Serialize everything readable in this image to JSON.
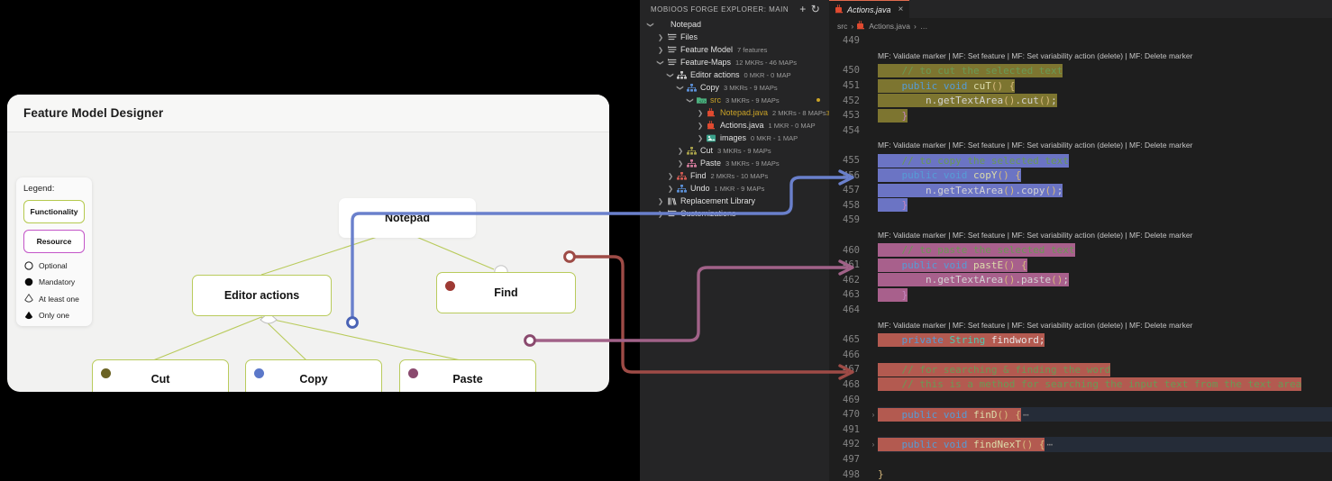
{
  "designer": {
    "title": "Feature Model Designer",
    "legend": {
      "title": "Legend:",
      "chips": [
        {
          "label": "Functionality",
          "color": "#b5c94e"
        },
        {
          "label": "Resource",
          "color": "#c355c8"
        }
      ],
      "symbols": [
        {
          "name": "optional",
          "label": "Optional"
        },
        {
          "name": "mandatory",
          "label": "Mandatory"
        },
        {
          "name": "at-least-one",
          "label": "At least one"
        },
        {
          "name": "only-one",
          "label": "Only one"
        }
      ]
    },
    "nodes": [
      {
        "id": "notepad",
        "label": "Notepad",
        "dot": null
      },
      {
        "id": "editor-actions",
        "label": "Editor actions",
        "dot": null
      },
      {
        "id": "find",
        "label": "Find",
        "dot": "#9e3a34"
      },
      {
        "id": "cut",
        "label": "Cut",
        "dot": "#6b6324"
      },
      {
        "id": "copy",
        "label": "Copy",
        "dot": "#5b78c9"
      },
      {
        "id": "paste",
        "label": "Paste",
        "dot": "#8a4a6e"
      }
    ],
    "trace_colors": {
      "copy": "#6a80cc",
      "find": "#9e4b46",
      "paste": "#a16288"
    }
  },
  "explorer": {
    "header": {
      "title": "MOBIOOS FORGE EXPLORER: MAIN",
      "add_icon": "plus-icon",
      "refresh_icon": "refresh-icon"
    },
    "tree": [
      {
        "indent": 0,
        "tw": "v",
        "icon": "none",
        "label": "Notepad",
        "meta": ""
      },
      {
        "indent": 1,
        "tw": ">",
        "icon": "list",
        "label": "Files",
        "meta": ""
      },
      {
        "indent": 1,
        "tw": ">",
        "icon": "list",
        "label": "Feature Model",
        "meta": "7 features"
      },
      {
        "indent": 1,
        "tw": "v",
        "icon": "list",
        "label": "Feature-Maps",
        "meta": "12 MKRs - 46 MAPs"
      },
      {
        "indent": 2,
        "tw": "v",
        "icon": "hier-grey",
        "label": "Editor actions",
        "meta": "0 MKR - 0 MAP"
      },
      {
        "indent": 3,
        "tw": "v",
        "icon": "hier-blue",
        "label": "Copy",
        "meta": "3 MKRs - 9 MAPs"
      },
      {
        "indent": 4,
        "tw": "v",
        "icon": "folder",
        "label": "src",
        "meta": "3 MKRs - 9 MAPs",
        "label_color": "#c9a227",
        "dotmark": true
      },
      {
        "indent": 5,
        "tw": ">",
        "icon": "java",
        "label": "Notepad.java",
        "meta": "2 MKRs - 8 MAPs",
        "label_color": "#c9a227",
        "badge": "3"
      },
      {
        "indent": 5,
        "tw": ">",
        "icon": "java",
        "label": "Actions.java",
        "meta": "1 MKR - 0 MAP"
      },
      {
        "indent": 5,
        "tw": ">",
        "icon": "images",
        "label": "images",
        "meta": "0 MKR - 1 MAP"
      },
      {
        "indent": 3,
        "tw": ">",
        "icon": "hier-olive",
        "label": "Cut",
        "meta": "3 MKRs - 9 MAPs"
      },
      {
        "indent": 3,
        "tw": ">",
        "icon": "hier-pink",
        "label": "Paste",
        "meta": "3 MKRs - 9 MAPs"
      },
      {
        "indent": 2,
        "tw": ">",
        "icon": "hier-red",
        "label": "Find",
        "meta": "2 MKRs - 10 MAPs"
      },
      {
        "indent": 2,
        "tw": ">",
        "icon": "hier-blue",
        "label": "Undo",
        "meta": "1 MKR - 9 MAPs"
      },
      {
        "indent": 1,
        "tw": ">",
        "icon": "library",
        "label": "Replacement Library",
        "meta": ""
      },
      {
        "indent": 1,
        "tw": ">",
        "icon": "list",
        "label": "Customizations",
        "meta": ""
      }
    ]
  },
  "editor": {
    "tab": {
      "label": "Actions.java",
      "icon": "java-icon",
      "close": "×"
    },
    "breadcrumb": {
      "root": "src",
      "file": "Actions.java",
      "more": "…",
      "sep": "›"
    },
    "marker_text": "MF: Validate marker | MF: Set feature | MF: Set variability action (delete) | MF: Delete marker",
    "lines": [
      {
        "num": "449"
      },
      {
        "marker": true
      },
      {
        "num": "450",
        "hl": "#7d7530",
        "tokens": [
          {
            "t": "    // to cut the selected text",
            "c": "c"
          }
        ]
      },
      {
        "num": "451",
        "hl": "#7d7530",
        "tokens": [
          {
            "t": "    ",
            "c": "n"
          },
          {
            "t": "public",
            "c": "k"
          },
          {
            "t": " ",
            "c": "n"
          },
          {
            "t": "void",
            "c": "k"
          },
          {
            "t": " ",
            "c": "n"
          },
          {
            "t": "cuT",
            "c": "m"
          },
          {
            "t": "()",
            "c": "y"
          },
          {
            "t": " {",
            "c": "y"
          }
        ]
      },
      {
        "num": "452",
        "hl": "#7d7530",
        "tokens": [
          {
            "t": "        n.getTextArea",
            "c": "n"
          },
          {
            "t": "()",
            "c": "y"
          },
          {
            "t": ".cut",
            "c": "n"
          },
          {
            "t": "()",
            "c": "y"
          },
          {
            "t": ";",
            "c": "n"
          }
        ]
      },
      {
        "num": "453",
        "hl": "#7d7530",
        "tokens": [
          {
            "t": "    }",
            "c": "p"
          }
        ]
      },
      {
        "num": "454"
      },
      {
        "marker": true
      },
      {
        "num": "455",
        "hl": "#6b74c4",
        "tokens": [
          {
            "t": "    // to copy the selected text",
            "c": "c"
          }
        ]
      },
      {
        "num": "456",
        "hl": "#6b74c4",
        "tokens": [
          {
            "t": "    ",
            "c": "n"
          },
          {
            "t": "public",
            "c": "k"
          },
          {
            "t": " ",
            "c": "n"
          },
          {
            "t": "void",
            "c": "k"
          },
          {
            "t": " ",
            "c": "n"
          },
          {
            "t": "copY",
            "c": "m"
          },
          {
            "t": "()",
            "c": "y"
          },
          {
            "t": " {",
            "c": "y"
          }
        ]
      },
      {
        "num": "457",
        "hl": "#6b74c4",
        "tokens": [
          {
            "t": "        n.getTextArea",
            "c": "n"
          },
          {
            "t": "()",
            "c": "y"
          },
          {
            "t": ".copy",
            "c": "n"
          },
          {
            "t": "()",
            "c": "y"
          },
          {
            "t": ";",
            "c": "n"
          }
        ]
      },
      {
        "num": "458",
        "hl": "#6b74c4",
        "tokens": [
          {
            "t": "    }",
            "c": "p"
          }
        ]
      },
      {
        "num": "459"
      },
      {
        "marker": true
      },
      {
        "num": "460",
        "hl": "#a8608c",
        "tokens": [
          {
            "t": "    // to paste the selected text",
            "c": "c"
          }
        ]
      },
      {
        "num": "461",
        "hl": "#a8608c",
        "tokens": [
          {
            "t": "    ",
            "c": "n"
          },
          {
            "t": "public",
            "c": "k"
          },
          {
            "t": " ",
            "c": "n"
          },
          {
            "t": "void",
            "c": "k"
          },
          {
            "t": " ",
            "c": "n"
          },
          {
            "t": "pastE",
            "c": "m"
          },
          {
            "t": "()",
            "c": "y"
          },
          {
            "t": " {",
            "c": "y"
          }
        ]
      },
      {
        "num": "462",
        "hl": "#a8608c",
        "tokens": [
          {
            "t": "        n.getTextArea",
            "c": "n"
          },
          {
            "t": "()",
            "c": "y"
          },
          {
            "t": ".paste",
            "c": "n"
          },
          {
            "t": "()",
            "c": "y"
          },
          {
            "t": ";",
            "c": "n"
          }
        ]
      },
      {
        "num": "463",
        "hl": "#a8608c",
        "tokens": [
          {
            "t": "    }",
            "c": "p"
          }
        ]
      },
      {
        "num": "464"
      },
      {
        "marker": true
      },
      {
        "num": "465",
        "hl": "#b35a50",
        "tokens": [
          {
            "t": "    ",
            "c": "n"
          },
          {
            "t": "private",
            "c": "k"
          },
          {
            "t": " ",
            "c": "n"
          },
          {
            "t": "String",
            "c": "t"
          },
          {
            "t": " findword;",
            "c": "b"
          }
        ]
      },
      {
        "num": "466"
      },
      {
        "num": "467",
        "hl": "#b35a50",
        "tokens": [
          {
            "t": "    // for searching & finding the word",
            "c": "c"
          }
        ]
      },
      {
        "num": "468",
        "hl": "#b35a50",
        "tokens": [
          {
            "t": "    // this is a method for searching the input text from the text area",
            "c": "c"
          }
        ]
      },
      {
        "num": "469"
      },
      {
        "num": "470",
        "fold": "›",
        "hl": "#b35a50",
        "band": true,
        "tokens": [
          {
            "t": "    ",
            "c": "n"
          },
          {
            "t": "public",
            "c": "k"
          },
          {
            "t": " ",
            "c": "n"
          },
          {
            "t": "void",
            "c": "k"
          },
          {
            "t": " ",
            "c": "n"
          },
          {
            "t": "finD",
            "c": "m"
          },
          {
            "t": "()",
            "c": "y"
          },
          {
            "t": " {",
            "c": "y"
          }
        ],
        "ellipsis": "⋯"
      },
      {
        "num": "491"
      },
      {
        "num": "492",
        "fold": "›",
        "hl": "#b35a50",
        "band": true,
        "tokens": [
          {
            "t": "    ",
            "c": "n"
          },
          {
            "t": "public",
            "c": "k"
          },
          {
            "t": " ",
            "c": "n"
          },
          {
            "t": "void",
            "c": "k"
          },
          {
            "t": " ",
            "c": "n"
          },
          {
            "t": "findNexT",
            "c": "m"
          },
          {
            "t": "()",
            "c": "y"
          },
          {
            "t": " {",
            "c": "y"
          }
        ],
        "ellipsis": "⋯"
      },
      {
        "num": "497"
      },
      {
        "num": "498",
        "tokens": [
          {
            "t": "}",
            "c": "y"
          }
        ]
      }
    ]
  }
}
